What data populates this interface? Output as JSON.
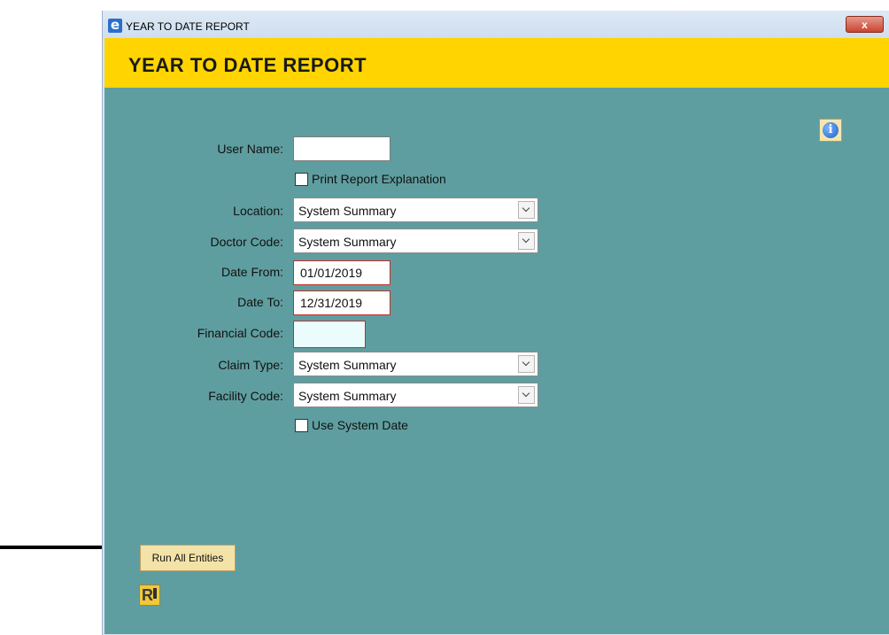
{
  "window": {
    "title": "YEAR TO DATE REPORT",
    "app_icon": "e",
    "close_label": "x"
  },
  "banner": {
    "title": "YEAR TO DATE REPORT"
  },
  "info_button": {
    "icon": "info-icon",
    "glyph": "i"
  },
  "form": {
    "user_name": {
      "label": "User Name:",
      "value": ""
    },
    "print_explanation": {
      "label": "Print Report Explanation",
      "checked": false
    },
    "location": {
      "label": "Location:",
      "value": "System Summary"
    },
    "doctor_code": {
      "label": "Doctor Code:",
      "value": "System Summary"
    },
    "date_from": {
      "label": "Date From:",
      "value": "01/01/2019"
    },
    "date_to": {
      "label": "Date To:",
      "value": "12/31/2019"
    },
    "financial_code": {
      "label": "Financial Code:",
      "value": ""
    },
    "claim_type": {
      "label": "Claim Type:",
      "value": "System Summary"
    },
    "facility_code": {
      "label": "Facility Code:",
      "value": "System Summary"
    },
    "use_system_date": {
      "label": "Use System Date",
      "checked": false
    }
  },
  "buttons": {
    "run_all_entities": "Run All Entities",
    "report_icon": "report-icon",
    "report_glyph": "R"
  },
  "colors": {
    "banner": "#ffd400",
    "panel": "#5f9ea0",
    "required_border": "#c0302b"
  }
}
